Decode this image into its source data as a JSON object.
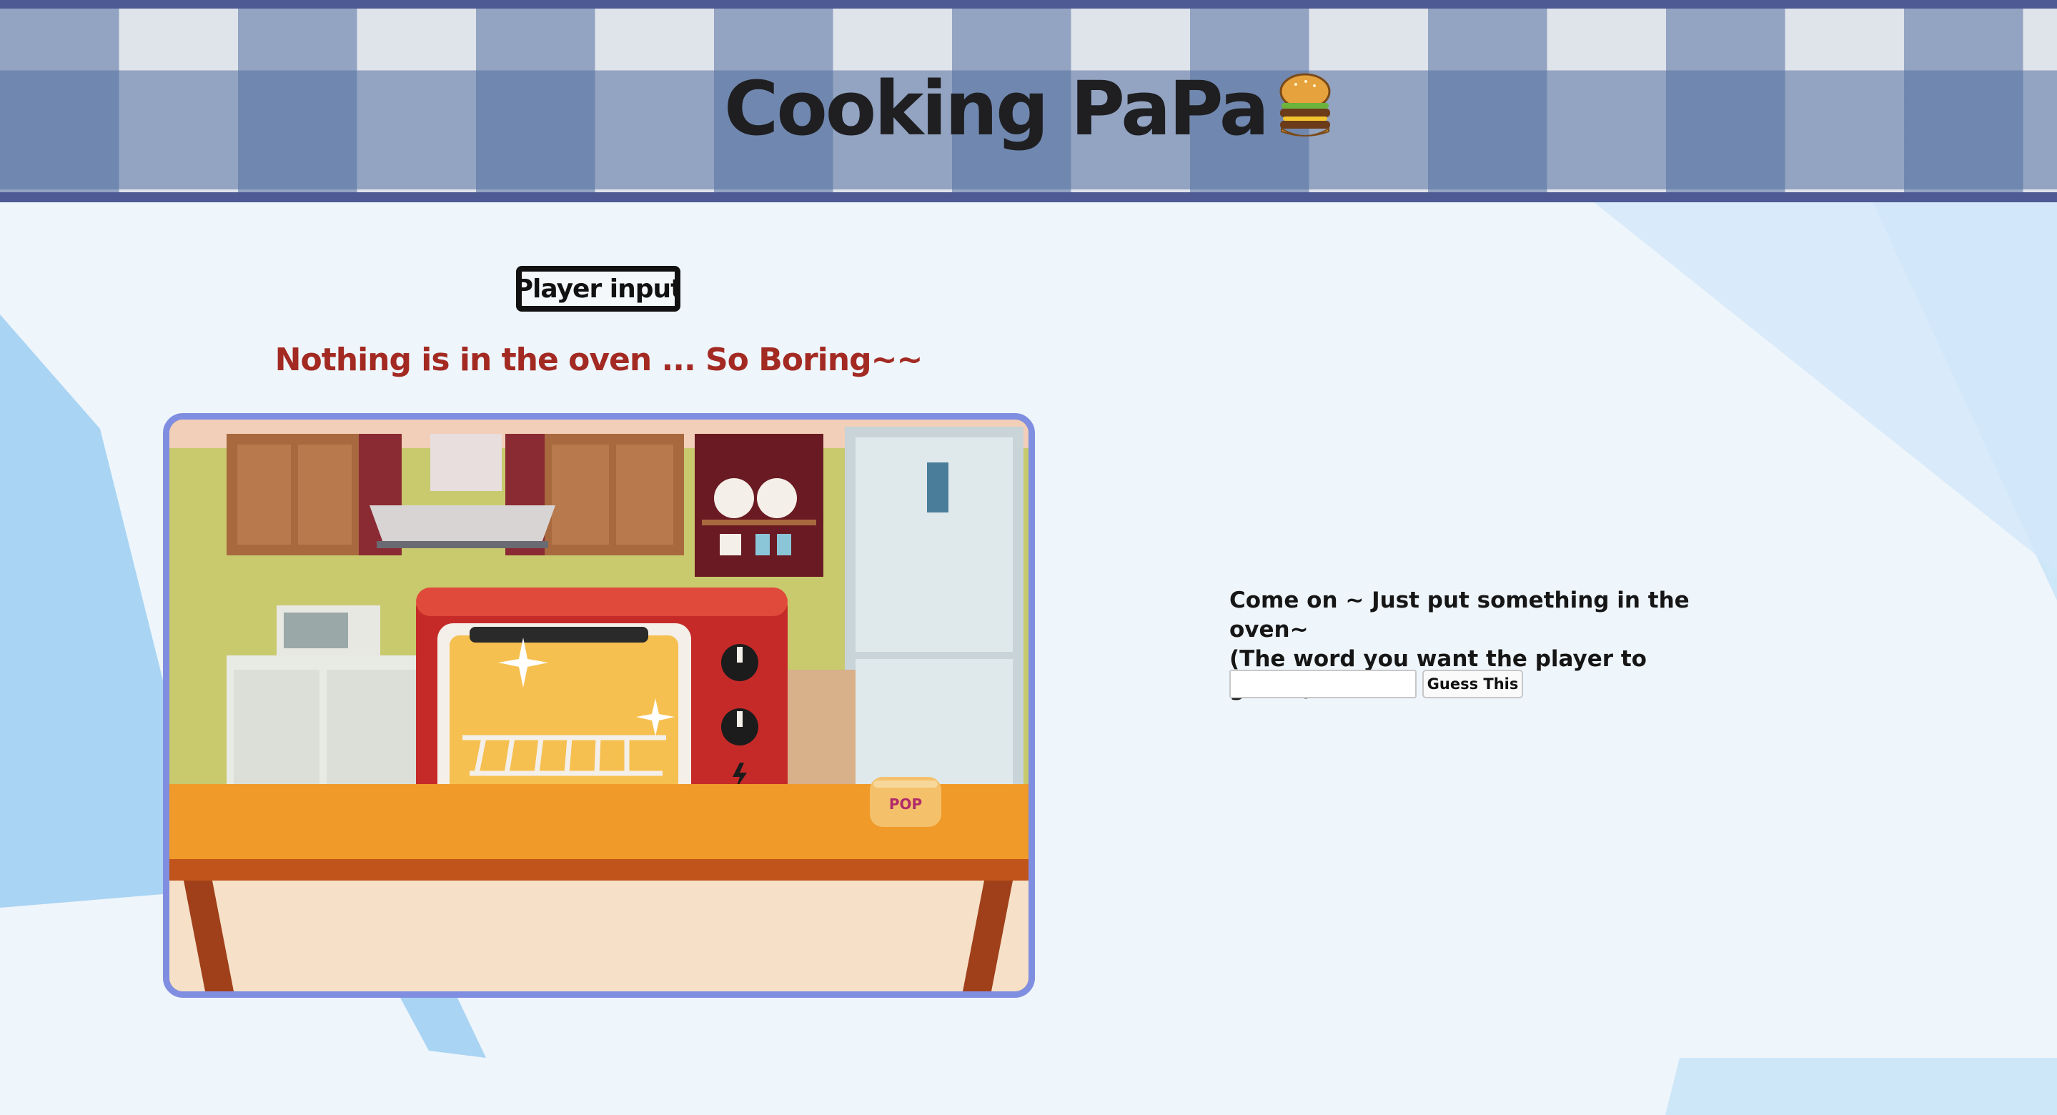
{
  "header": {
    "title": "Cooking PaPa",
    "title_icon": "burger-icon"
  },
  "player_input_label": "Player input",
  "status_text": "Nothing is in the oven ... So Boring~~",
  "scene": {
    "description_icon": "kitchen-oven-illustration",
    "toaster_label": "POP"
  },
  "prompt": {
    "line1": "Come on ~ Just put something in the oven~",
    "line2": "(The word you want the player to guess)"
  },
  "guess": {
    "input_value": "",
    "input_placeholder": "",
    "button_label": "Guess This"
  },
  "colors": {
    "header_border": "#4d5a93",
    "status_red": "#a32a22",
    "scene_border": "#7f8ee0",
    "background": "#eef5fb"
  }
}
